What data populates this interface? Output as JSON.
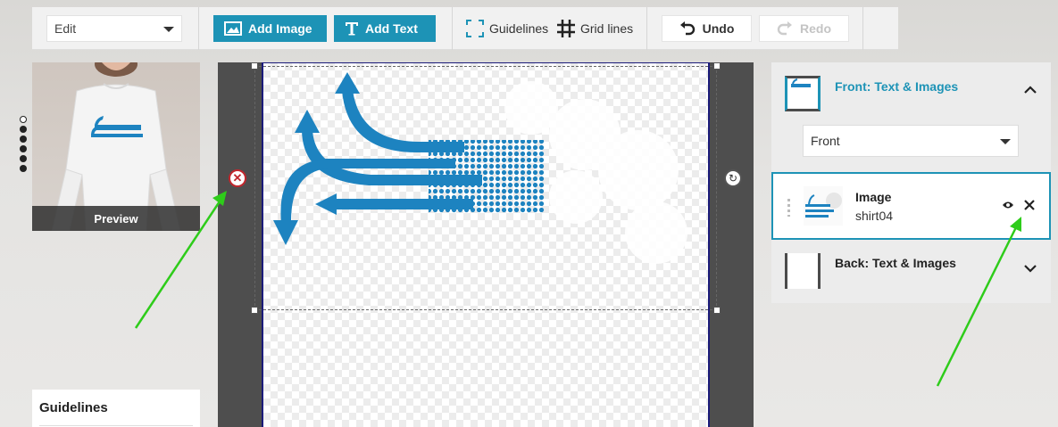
{
  "toolbar": {
    "mode_select": "Edit",
    "add_image": "Add Image",
    "add_text": "Add Text",
    "guidelines": "Guidelines",
    "grid_lines": "Grid lines",
    "undo": "Undo",
    "redo": "Redo"
  },
  "preview": {
    "label": "Preview"
  },
  "guidelines_panel": {
    "title": "Guidelines"
  },
  "right_panel": {
    "front_title": "Front: Text & Images",
    "side_select": "Front",
    "layer": {
      "type": "Image",
      "name": "shirt04"
    },
    "back_title": "Back: Text & Images"
  },
  "colors": {
    "accent": "#1d93b6",
    "print_border": "#1b1b7a",
    "annotation": "#2ecc1a"
  }
}
